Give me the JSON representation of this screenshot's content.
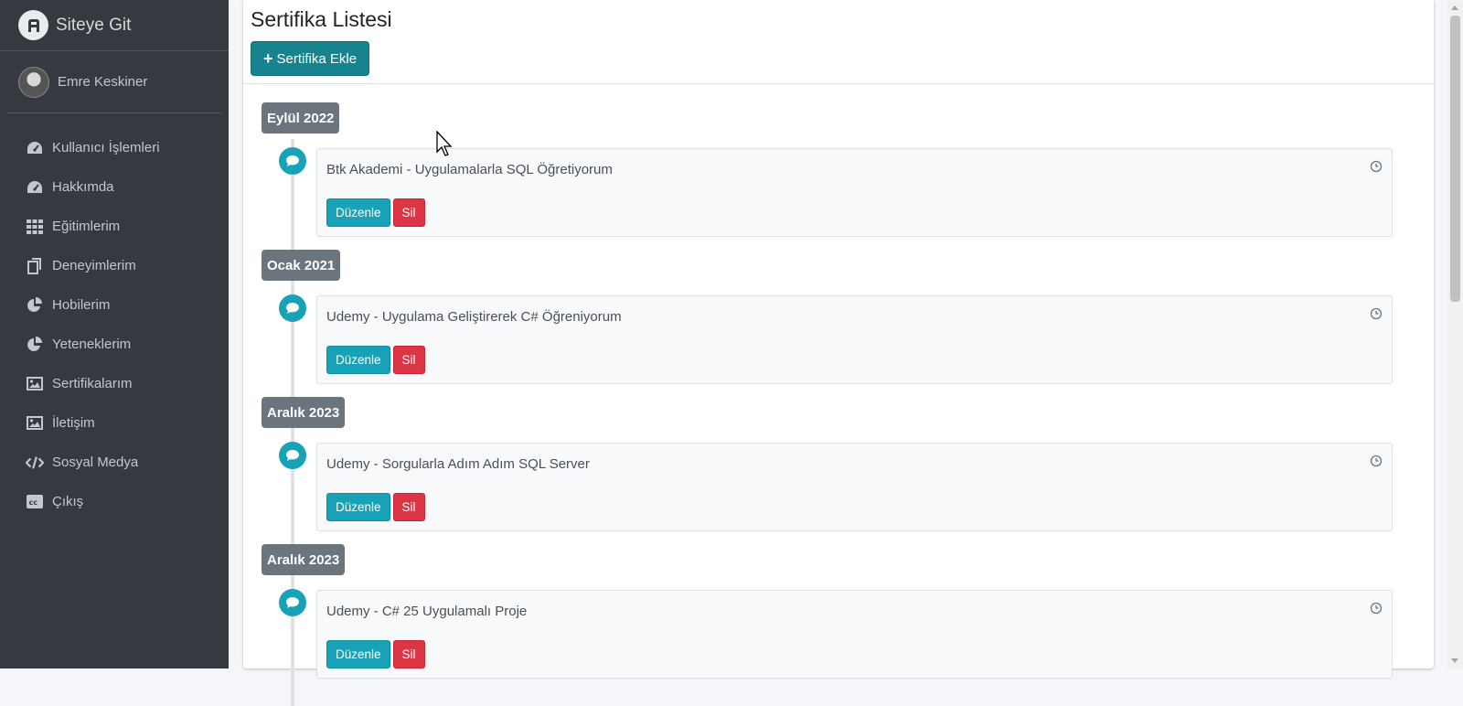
{
  "sidebar": {
    "brand": "Siteye Git",
    "user_name": "Emre Keskiner",
    "items": [
      {
        "label": "Kullanıcı İşlemleri",
        "icon": "tachometer-icon"
      },
      {
        "label": "Hakkımda",
        "icon": "tachometer-icon"
      },
      {
        "label": "Eğitimlerim",
        "icon": "grid-icon"
      },
      {
        "label": "Deneyimlerim",
        "icon": "copy-icon"
      },
      {
        "label": "Hobilerim",
        "icon": "pie-chart-icon"
      },
      {
        "label": "Yeteneklerim",
        "icon": "pie-chart-icon"
      },
      {
        "label": "Sertifikalarım",
        "icon": "image-icon"
      },
      {
        "label": "İletişim",
        "icon": "image-icon"
      },
      {
        "label": "Sosyal Medya",
        "icon": "code-icon"
      },
      {
        "label": "Çıkış",
        "icon": "closed-captioning-icon"
      }
    ]
  },
  "main": {
    "title": "Sertifika Listesi",
    "add_button": "Sertifika Ekle",
    "edit_label": "Düzenle",
    "delete_label": "Sil",
    "entries": [
      {
        "date": "Eylül 2022",
        "title": "Btk Akademi - Uygulamalarla SQL Öğretiyorum"
      },
      {
        "date": "Ocak 2021",
        "title": "Udemy - Uygulama Geliştirerek C# Öğreniyorum"
      },
      {
        "date": "Aralık 2023",
        "title": "Udemy - Sorgularla Adım Adım SQL Server"
      },
      {
        "date": "Aralık 2023",
        "title": "Udemy - C# 25 Uygulamalı Proje"
      }
    ]
  },
  "colors": {
    "sidebar_bg": "#343a40",
    "primary_teal": "#17838f",
    "info": "#17a2b8",
    "danger": "#dc3545",
    "date_badge": "#6c757d"
  }
}
